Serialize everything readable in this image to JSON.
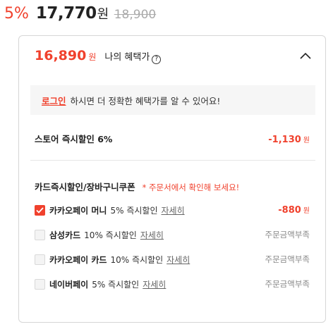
{
  "price": {
    "discount_rate": "5%",
    "final_price": "17,770",
    "currency": "원",
    "original_price": "18,900"
  },
  "benefit": {
    "amount": "16,890",
    "currency": "원",
    "label": "나의 혜택가",
    "help_symbol": "?"
  },
  "login_banner": {
    "link": "로그인",
    "text": "하시면 더 정확한 혜택가를 알 수 있어요!"
  },
  "store_discount": {
    "label": "스토어 즉시할인 6%",
    "value": "-1,130",
    "currency": "원"
  },
  "card_section": {
    "title": "카드즉시할인/장바구니쿠폰",
    "note": "* 주문서에서 확인해 보세요!",
    "options": [
      {
        "name": "카카오페이 머니",
        "rate": "5% 즉시할인",
        "detail": "자세히",
        "checked": true,
        "value": "-880",
        "currency": "원",
        "status": ""
      },
      {
        "name": "삼성카드",
        "rate": "10% 즉시할인",
        "detail": "자세히",
        "checked": false,
        "value": "",
        "currency": "",
        "status": "주문금액부족"
      },
      {
        "name": "카카오페이 카드",
        "rate": "10% 즉시할인",
        "detail": "자세히",
        "checked": false,
        "value": "",
        "currency": "",
        "status": "주문금액부족"
      },
      {
        "name": "네이버페이",
        "rate": "5% 즉시할인",
        "detail": "자세히",
        "checked": false,
        "value": "",
        "currency": "",
        "status": "주문금액부족"
      }
    ]
  },
  "colors": {
    "accent": "#f0412d",
    "border": "#d6d6d6",
    "banner_bg": "#f6f6f6"
  },
  "icons": {
    "collapse": "chevron-up-icon",
    "help": "question-circle-icon",
    "check": "check-icon"
  }
}
